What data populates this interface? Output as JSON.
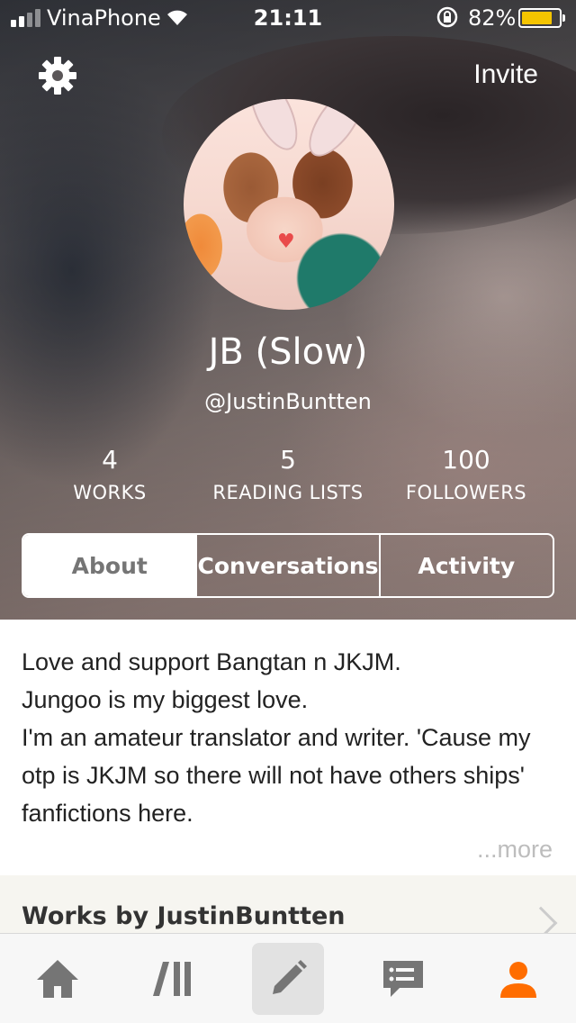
{
  "status_bar": {
    "carrier": "VinaPhone",
    "time": "21:11",
    "battery": "82%"
  },
  "header": {
    "invite_label": "Invite"
  },
  "profile": {
    "name": "JB (Slow)",
    "handle": "@JustinBuntten"
  },
  "stats": [
    {
      "value": "4",
      "label": "WORKS"
    },
    {
      "value": "5",
      "label": "READING LISTS"
    },
    {
      "value": "100",
      "label": "FOLLOWERS"
    }
  ],
  "tabs": [
    {
      "label": "About",
      "active": true
    },
    {
      "label": "Conversations",
      "active": false
    },
    {
      "label": "Activity",
      "active": false
    }
  ],
  "about": {
    "lines": [
      "Love and support Bangtan n JKJM.",
      "Jungoo is my biggest love.",
      "I'm an amateur translator and writer. 'Cause my otp is JKJM so there will not have others ships' fanfictions here."
    ],
    "more_label": "...more"
  },
  "works_section": {
    "title": "Works by JustinBuntten"
  },
  "bottom_nav": [
    {
      "icon": "home-icon",
      "selected": false
    },
    {
      "icon": "library-icon",
      "selected": false
    },
    {
      "icon": "pencil-icon",
      "selected": true
    },
    {
      "icon": "messages-icon",
      "selected": false
    },
    {
      "icon": "profile-icon",
      "selected": false
    }
  ],
  "colors": {
    "accent": "#ff6d00",
    "battery": "#f5c400",
    "nav_icon": "#757575"
  }
}
